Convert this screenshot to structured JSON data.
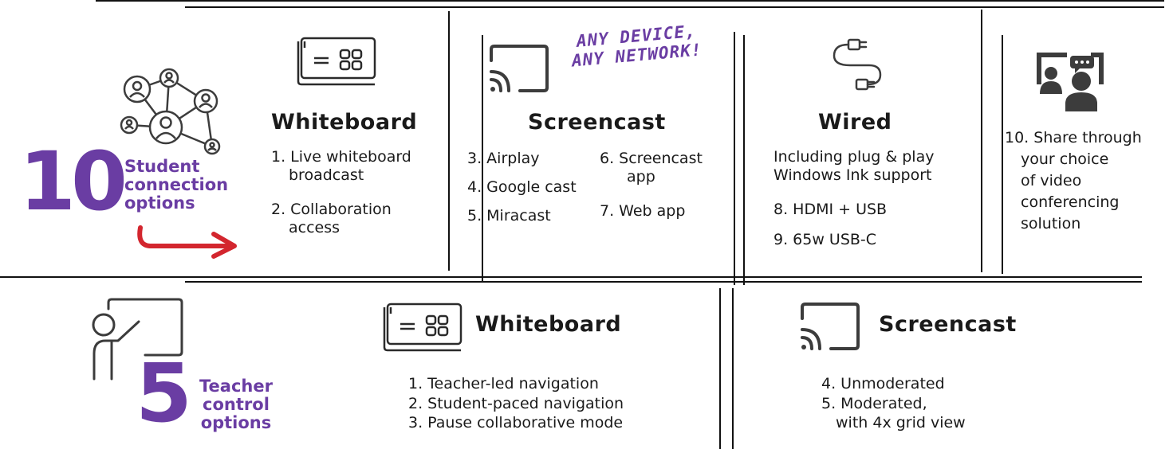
{
  "student": {
    "count": "10",
    "label_lines": [
      "Student",
      "connection",
      "options"
    ],
    "whiteboard": {
      "title": "Whiteboard",
      "items": [
        [
          "1. Live whiteboard",
          "broadcast"
        ],
        [
          "2. Collaboration",
          "access"
        ]
      ]
    },
    "screencast": {
      "title": "Screencast",
      "callout_lines": [
        "ANY DEVICE,",
        "ANY NETWORK!"
      ],
      "left_items": [
        "3. Airplay",
        "4. Google cast",
        "5. Miracast"
      ],
      "right_items": [
        [
          "6. Screencast",
          "app"
        ],
        [
          "7. Web app"
        ]
      ]
    },
    "wired": {
      "title": "Wired",
      "intro_lines": [
        "Including plug & play",
        "Windows Ink support"
      ],
      "items": [
        "8. HDMI + USB",
        "9. 65w USB-C"
      ]
    },
    "video": {
      "lines": [
        "10. Share through",
        "your choice",
        "of video",
        "conferencing",
        "solution"
      ]
    }
  },
  "teacher": {
    "count": "5",
    "label_lines": [
      "Teacher",
      "control",
      "options"
    ],
    "whiteboard": {
      "title": "Whiteboard",
      "items": [
        "1. Teacher-led navigation",
        "2. Student-paced navigation",
        "3. Pause collaborative mode"
      ]
    },
    "screencast": {
      "title": "Screencast",
      "items": [
        [
          "4. Unmoderated"
        ],
        [
          "5. Moderated,",
          "with 4x grid view"
        ]
      ]
    }
  },
  "colors": {
    "accent": "#6a3da3",
    "arrow": "#d3262e",
    "rule": "#111111",
    "icon": "#3c3c3c"
  },
  "icons": [
    "network-people-icon",
    "whiteboard-icon",
    "screencast-icon",
    "cable-icon",
    "video-conference-icon",
    "teacher-icon",
    "arrow-icon"
  ]
}
